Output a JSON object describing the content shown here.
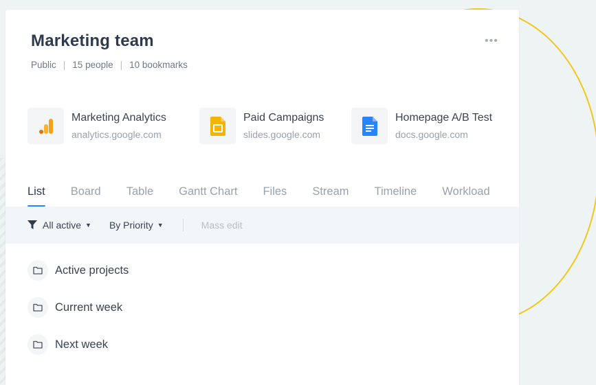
{
  "team": {
    "title": "Marketing team",
    "visibility": "Public",
    "people": "15 people",
    "bookmarks_count": "10 bookmarks",
    "more_icon": "ellipsis-icon"
  },
  "bookmarks": [
    {
      "name": "Marketing Analytics",
      "url": "analytics.google.com",
      "icon": "analytics-icon",
      "color": "#f4a21b"
    },
    {
      "name": "Paid Campaigns",
      "url": "slides.google.com",
      "icon": "slides-icon",
      "color": "#f4b400"
    },
    {
      "name": "Homepage A/B Test",
      "url": "docs.google.com",
      "icon": "docs-icon",
      "color": "#2684fc"
    }
  ],
  "tabs": [
    {
      "label": "List",
      "active": true
    },
    {
      "label": "Board"
    },
    {
      "label": "Table"
    },
    {
      "label": "Gantt Chart"
    },
    {
      "label": "Files"
    },
    {
      "label": "Stream"
    },
    {
      "label": "Timeline"
    },
    {
      "label": "Workload"
    }
  ],
  "toolbar": {
    "filter_label": "All active",
    "sort_label": "By Priority",
    "mass_edit_label": "Mass edit"
  },
  "folders": [
    {
      "label": "Active projects"
    },
    {
      "label": "Current week"
    },
    {
      "label": "Next week"
    }
  ],
  "colors": {
    "accent": "#1a8ff0",
    "ring": "#f5c518",
    "background": "#eef4f3"
  }
}
